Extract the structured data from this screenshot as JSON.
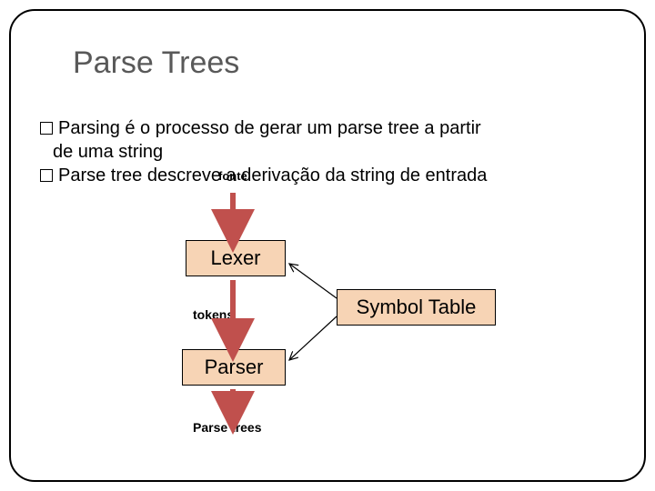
{
  "title": "Parse Trees",
  "bullets": {
    "b1": "Parsing é o processo de gerar um parse tree a partir",
    "b2": "de uma string",
    "b3": "Parse tree descreve a derivação da string de entrada"
  },
  "labels": {
    "fonte": "fonte",
    "tokens": "tokens",
    "parsetrees": "Parse trees"
  },
  "boxes": {
    "lexer": "Lexer",
    "parser": "Parser",
    "symtab": "Symbol Table"
  },
  "colors": {
    "box_fill": "#f7d4b5",
    "arrow": "#c0504d",
    "thin_arrow": "#000"
  }
}
